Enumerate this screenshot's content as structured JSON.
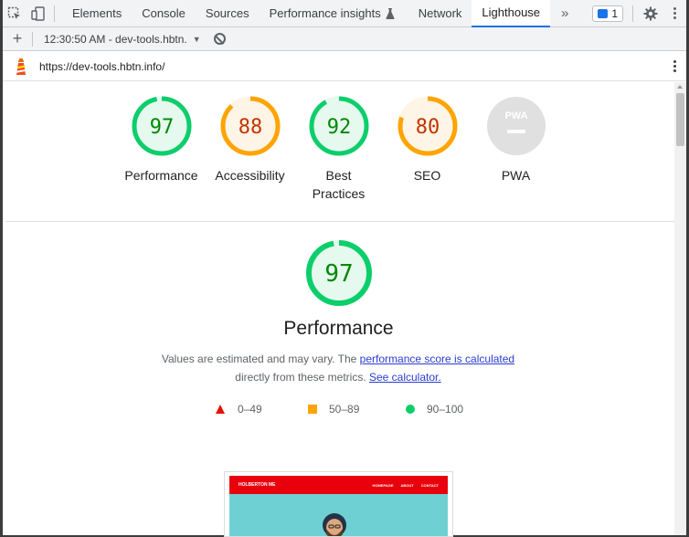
{
  "devtools": {
    "tabs": [
      {
        "label": "Elements"
      },
      {
        "label": "Console"
      },
      {
        "label": "Sources"
      },
      {
        "label": "Performance insights"
      },
      {
        "label": "Network"
      },
      {
        "label": "Lighthouse"
      }
    ],
    "active_tab": "Lighthouse",
    "issues_count": "1"
  },
  "toolbar": {
    "report_label": "12:30:50 AM - dev-tools.hbtn."
  },
  "url_bar": {
    "url": "https://dev-tools.hbtn.info/"
  },
  "categories": [
    {
      "name": "Performance",
      "score": "97",
      "status": "pass",
      "fraction": 0.97
    },
    {
      "name": "Accessibility",
      "score": "88",
      "status": "average",
      "fraction": 0.88
    },
    {
      "name": "Best Practices",
      "score": "92",
      "status": "pass",
      "fraction": 0.92
    },
    {
      "name": "SEO",
      "score": "80",
      "status": "average",
      "fraction": 0.8
    },
    {
      "name": "PWA",
      "score": "",
      "status": "na",
      "fraction": 0
    }
  ],
  "pwa_badge_text": "PWA",
  "performance": {
    "score": "97",
    "fraction": 0.97,
    "title": "Performance",
    "desc_text_1": "Values are estimated and may vary. The ",
    "desc_link_1": "performance score is calculated",
    "desc_text_2": "directly from these metrics. ",
    "desc_link_2": "See calculator."
  },
  "legend": {
    "fail": "0–49",
    "average": "50–89",
    "pass": "90–100"
  },
  "thumbnail": {
    "site_name": "HOLBERTON ME",
    "nav_links": [
      "HOMEPAGE",
      "ABOUT",
      "CONTACT"
    ]
  },
  "colors": {
    "pass": "#0cce6b",
    "pass_text": "#008800",
    "pass_bg": "#e6f9ef",
    "average": "#ffa400",
    "average_text": "#c33300",
    "average_bg": "#fff5e6",
    "fail": "#eb0f00",
    "na": "#e0e0e0",
    "accent": "#1a73e8"
  }
}
